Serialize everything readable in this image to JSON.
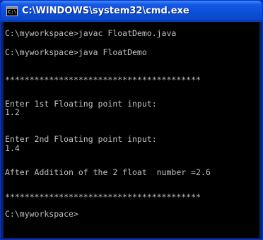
{
  "window": {
    "title": "C:\\WINDOWS\\system32\\cmd.exe",
    "icon_glyph": "C:\\",
    "icon_name": "command-prompt-icon"
  },
  "console": {
    "lines": [
      "C:\\myworkspace>javac FloatDemo.java",
      "C:\\myworkspace>java FloatDemo",
      "****************************************",
      "Enter 1st Floating point input:",
      "1.2",
      "Enter 2nd Floating point input:",
      "1.4",
      "After Addition of the 2 float  number =2.6",
      "****************************************",
      "C:\\myworkspace>"
    ]
  },
  "colors": {
    "title_bar": "#0b4fd6",
    "console_background": "#000000",
    "console_text": "#c0c0c0"
  }
}
